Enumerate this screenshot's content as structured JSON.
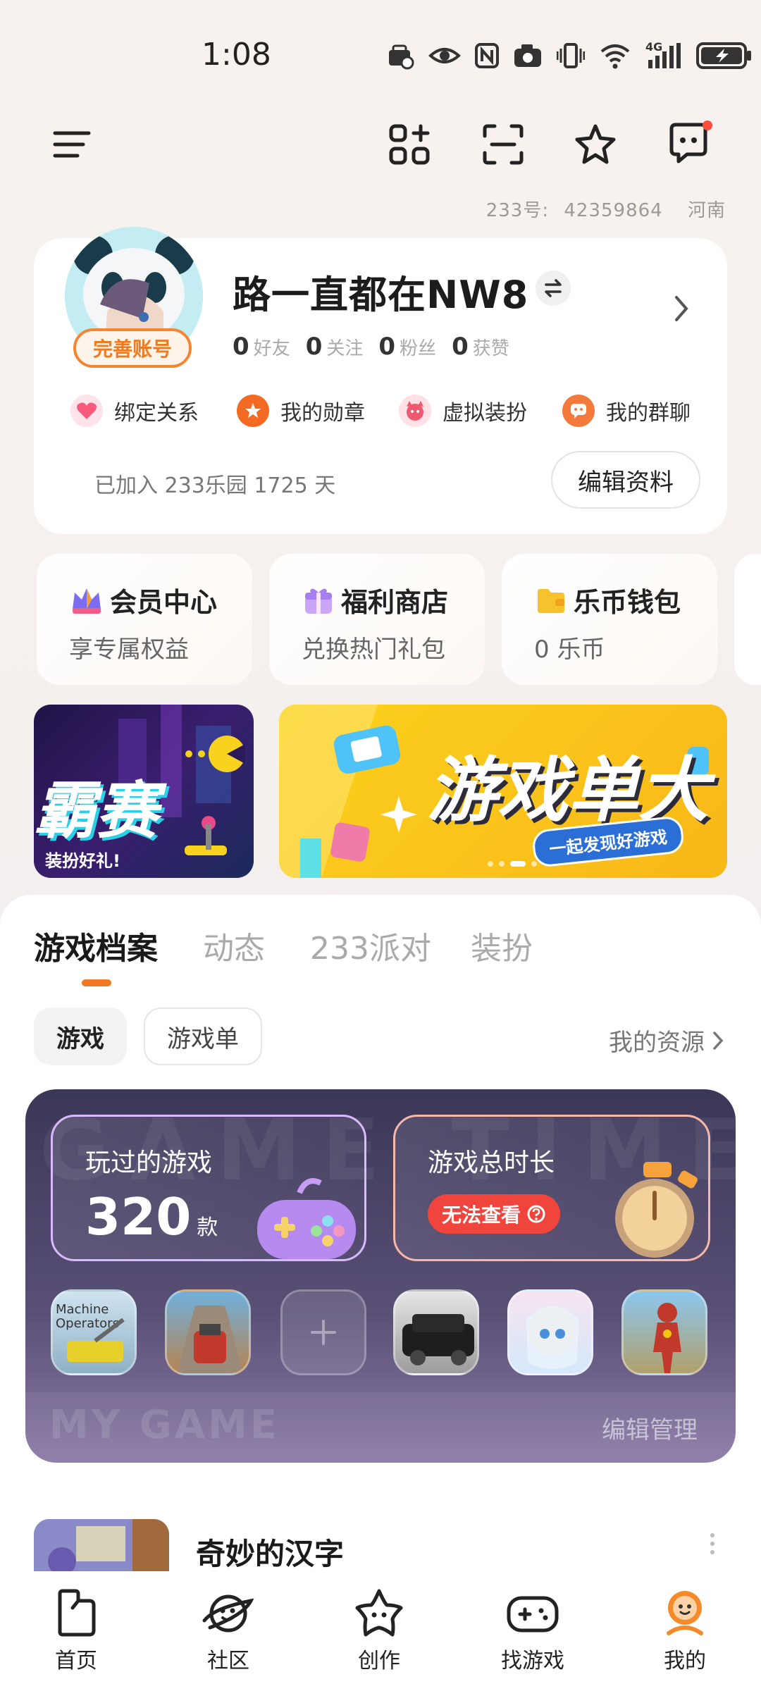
{
  "status_bar": {
    "time": "1:08",
    "network": "4G"
  },
  "header": {
    "id_label": "233号:",
    "id_value": "42359864",
    "region": "河南"
  },
  "profile": {
    "username": "路一直都在NW8",
    "complete_badge": "完善账号",
    "stats": [
      {
        "value": "0",
        "label": "好友"
      },
      {
        "value": "0",
        "label": "关注"
      },
      {
        "value": "0",
        "label": "粉丝"
      },
      {
        "value": "0",
        "label": "获赞"
      }
    ],
    "shortcuts": [
      {
        "label": "绑定关系",
        "icon": "heart-icon",
        "color": "#f75a7a"
      },
      {
        "label": "我的勋章",
        "icon": "medal-icon",
        "color": "#f56a22"
      },
      {
        "label": "虚拟装扮",
        "icon": "costume-icon",
        "color": "#f05a70"
      },
      {
        "label": "我的群聊",
        "icon": "group-chat-icon",
        "color": "#f47a3c"
      }
    ],
    "joined_text": "已加入 233乐园 1725 天",
    "edit_button": "编辑资料"
  },
  "quick_cards": [
    {
      "title": "会员中心",
      "subtitle": "享专属权益",
      "icon": "crown-icon"
    },
    {
      "title": "福利商店",
      "subtitle": "兑换热门礼包",
      "icon": "gift-icon"
    },
    {
      "title": "乐币钱包",
      "subtitle": "0 乐币",
      "icon": "wallet-icon"
    }
  ],
  "banners": [
    {
      "text": "霸赛",
      "sub": "装扮好礼!"
    },
    {
      "text": "游戏单大",
      "sub": "一起发现好游戏"
    }
  ],
  "tabs": [
    "游戏档案",
    "动态",
    "233派对",
    "装扮"
  ],
  "chips": [
    "游戏",
    "游戏单"
  ],
  "resources_link": "我的资源",
  "game_stats": {
    "watermark_top": "GAME TIME",
    "watermark_bottom": "MY GAME",
    "played_label": "玩过的游戏",
    "played_count": "320",
    "played_unit": "款",
    "duration_label": "游戏总时长",
    "duration_status": "无法查看",
    "manage_label": "编辑管理",
    "tile_text": "Machine Operators"
  },
  "recent_game": {
    "title": "奇妙的汉字"
  },
  "bottom_nav": [
    {
      "label": "首页",
      "icon": "home-icon"
    },
    {
      "label": "社区",
      "icon": "planet-icon"
    },
    {
      "label": "创作",
      "icon": "star-icon"
    },
    {
      "label": "找游戏",
      "icon": "gamepad-icon"
    },
    {
      "label": "我的",
      "icon": "profile-icon"
    }
  ]
}
